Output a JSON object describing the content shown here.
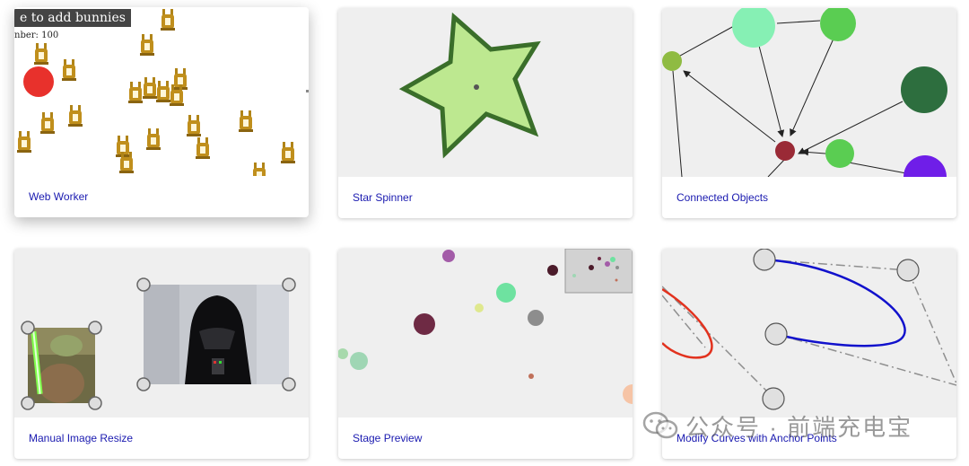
{
  "demos": [
    {
      "label": "Web Worker",
      "overlay_text": "e to add bunnies",
      "counter_text": "nber: 100"
    },
    {
      "label": "Star Spinner"
    },
    {
      "label": "Connected Objects"
    },
    {
      "label": "Manual Image Resize"
    },
    {
      "label": "Stage Preview"
    },
    {
      "label": "Modify Curves with Anchor Points"
    }
  ],
  "watermark": {
    "text": "公众号 · 前端充电宝"
  },
  "colors": {
    "link": "#1a1ab0",
    "preview_bg": "#efefef"
  }
}
